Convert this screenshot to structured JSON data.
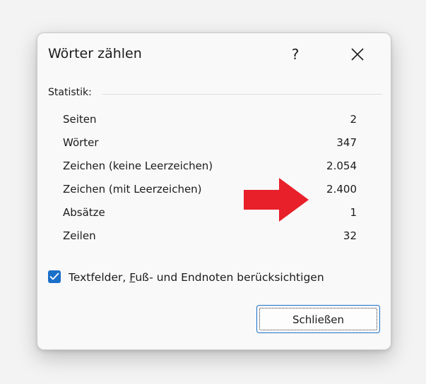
{
  "dialog": {
    "title": "Wörter zählen",
    "help_label": "?"
  },
  "statistics": {
    "label": "Statistik:",
    "rows": [
      {
        "label": "Seiten",
        "value": "2"
      },
      {
        "label": "Wörter",
        "value": "347"
      },
      {
        "label": "Zeichen (keine Leerzeichen)",
        "value": "2.054"
      },
      {
        "label": "Zeichen (mit Leerzeichen)",
        "value": "2.400"
      },
      {
        "label": "Absätze",
        "value": "1"
      },
      {
        "label": "Zeilen",
        "value": "32"
      }
    ]
  },
  "option": {
    "checked": true,
    "label_before": "Textfelder, ",
    "label_accel": "F",
    "label_after": "uß- und Endnoten berücksichtigen"
  },
  "footer": {
    "close_label": "Schließen"
  },
  "colors": {
    "accent": "#1a6fc9",
    "arrow": "#e8202a"
  },
  "icons": {
    "close": "close-icon",
    "check": "checkmark-icon",
    "arrow": "arrow-right-icon"
  }
}
